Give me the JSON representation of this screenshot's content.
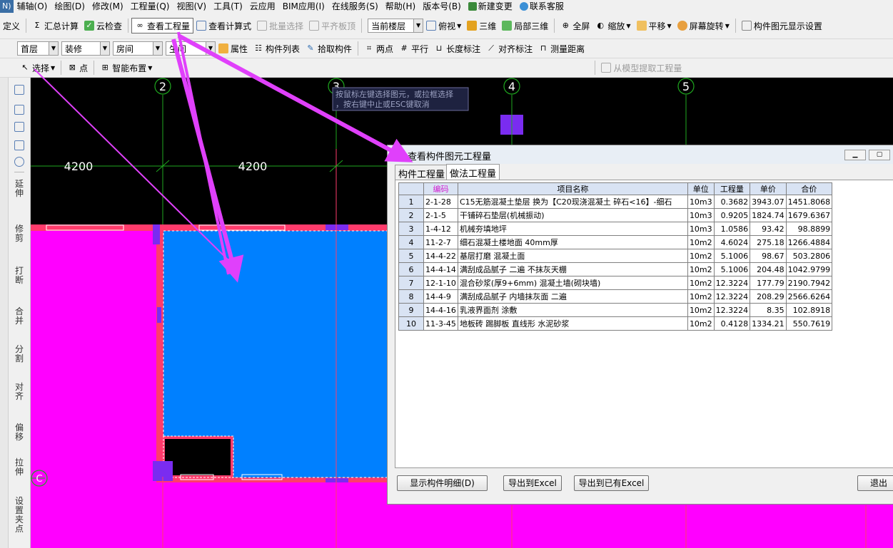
{
  "menubar": {
    "cut_label": "N)",
    "items": [
      "辅轴(O)",
      "绘图(D)",
      "修改(M)",
      "工程量(Q)",
      "视图(V)",
      "工具(T)",
      "云应用",
      "BIM应用(I)",
      "在线服务(S)",
      "帮助(H)",
      "版本号(B)",
      "新建变更",
      "联系客服"
    ]
  },
  "toolbar1": {
    "define": "定义",
    "sum_calc": "汇总计算",
    "cloud_check": "云检查",
    "view_quantity": "查看工程量",
    "view_formula": "查看计算式",
    "batch_select": "批量选择",
    "level_slab": "平齐板顶",
    "floor_scope": "当前楼层",
    "top_view": "俯视",
    "three_d": "三维",
    "local_3d": "局部三维",
    "fullscreen": "全屏",
    "zoom": "缩放",
    "pan": "平移",
    "rotate": "屏幕旋转",
    "display_settings": "构件图元显示设置"
  },
  "toolbar2": {
    "floor": "首层",
    "category": "装修",
    "type": "房间",
    "instance": "生间",
    "properties": "属性",
    "component_list": "构件列表",
    "pick_component": "拾取构件",
    "two_point": "两点",
    "parallel": "平行",
    "length_dim": "长度标注",
    "align_dim": "对齐标注",
    "measure": "测量距离"
  },
  "toolbar3": {
    "select": "选择",
    "point": "点",
    "smart_layout": "智能布置",
    "extract": "从模型提取工程量"
  },
  "left_toolbar": {
    "extend": "延伸",
    "trim": "修剪",
    "break": "打断",
    "merge": "合并",
    "split": "分割",
    "align": "对齐",
    "offset": "偏移",
    "stretch": "拉伸",
    "grip": "设置夹点"
  },
  "canvas": {
    "axes": [
      "2",
      "3",
      "4",
      "5"
    ],
    "row_axes": [
      "C"
    ],
    "dims": [
      "4200",
      "4200"
    ],
    "tooltip_line1": "按鼠标左键选择图元，或拉框选择",
    "tooltip_line2": "，按右键中止或ESC键取消"
  },
  "dialog": {
    "title": "查看构件图元工程量",
    "tab_component": "构件工程量",
    "tab_method": "做法工程量",
    "headers": [
      "",
      "编码",
      "项目名称",
      "单位",
      "工程量",
      "单价",
      "合价"
    ],
    "rows": [
      [
        "1",
        "2-1-28",
        "C15无筋混凝土垫层 换为【C20现浇混凝土 碎石<16】-细石",
        "10m3",
        "0.3682",
        "3943.07",
        "1451.8068"
      ],
      [
        "2",
        "2-1-5",
        "干铺碎石垫层(机械振动)",
        "10m3",
        "0.9205",
        "1824.74",
        "1679.6367"
      ],
      [
        "3",
        "1-4-12",
        "机械夯填地坪",
        "10m3",
        "1.0586",
        "93.42",
        "98.8899"
      ],
      [
        "4",
        "11-2-7",
        "细石混凝土楼地面 40mm厚",
        "10m2",
        "4.6024",
        "275.18",
        "1266.4884"
      ],
      [
        "5",
        "14-4-22",
        "基层打磨  混凝土面",
        "10m2",
        "5.1006",
        "98.67",
        "503.2806"
      ],
      [
        "6",
        "14-4-14",
        "满刮成品腻子 二遍 不抹灰天棚",
        "10m2",
        "5.1006",
        "204.48",
        "1042.9799"
      ],
      [
        "7",
        "12-1-10",
        "混合砂浆(厚9+6mm) 混凝土墙(砌块墙)",
        "10m2",
        "12.3224",
        "177.79",
        "2190.7942"
      ],
      [
        "8",
        "14-4-9",
        "满刮成品腻子 内墙抹灰面 二遍",
        "10m2",
        "12.3224",
        "208.29",
        "2566.6264"
      ],
      [
        "9",
        "14-4-16",
        "乳液界面剂 涂敷",
        "10m2",
        "12.3224",
        "8.35",
        "102.8918"
      ],
      [
        "10",
        "11-3-45",
        "地板砖 踢脚板 直线形 水泥砂浆",
        "10m2",
        "0.4128",
        "1334.21",
        "550.7619"
      ]
    ],
    "btn_detail": "显示构件明细(D)",
    "btn_export": "导出到Excel",
    "btn_export_existing": "导出到已有Excel",
    "btn_exit": "退出"
  },
  "colors": {
    "room_fill": "#0080ff",
    "wall_fill": "#ff00ff",
    "arrow": "#e040fb",
    "grid": "#1fa81f"
  }
}
